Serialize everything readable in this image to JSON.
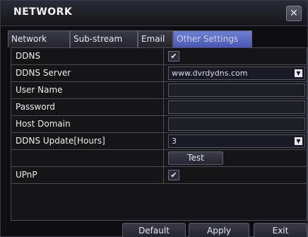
{
  "window": {
    "title": "NETWORK",
    "close_glyph": "✕"
  },
  "tabs": [
    {
      "label": "Network",
      "active": false
    },
    {
      "label": "Sub-stream",
      "active": false
    },
    {
      "label": "Email",
      "active": false
    },
    {
      "label": "Other Settings",
      "active": true
    }
  ],
  "rows": {
    "ddns": {
      "label": "DDNS",
      "checked": true,
      "check_glyph": "✔"
    },
    "ddns_server": {
      "label": "DDNS Server",
      "value": "www.dvrdydns.com"
    },
    "user_name": {
      "label": "User Name",
      "value": ""
    },
    "password": {
      "label": "Password",
      "value": ""
    },
    "host_domain": {
      "label": "Host Domain",
      "value": ""
    },
    "ddns_update": {
      "label": "DDNS Update[Hours]",
      "value": "3"
    },
    "test": {
      "label": "",
      "button": "Test"
    },
    "upnp": {
      "label": "UPnP",
      "checked": true,
      "check_glyph": "✔"
    }
  },
  "footer": {
    "default": "Default",
    "apply": "Apply",
    "exit": "Exit"
  },
  "icons": {
    "dropdown": "chevron-down-icon",
    "close": "close-icon",
    "check": "check-icon"
  },
  "colors": {
    "active_tab": "#5a68c4",
    "panel_border": "#4a4b57"
  }
}
